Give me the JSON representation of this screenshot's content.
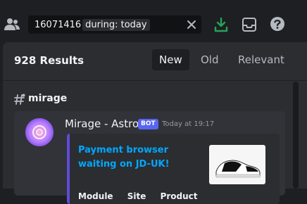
{
  "toolbar": {
    "search_query": "16071416",
    "search_filter": "during: today"
  },
  "results": {
    "count_label": "928 Results",
    "tabs": [
      "New",
      "Old",
      "Relevant"
    ],
    "active_tab": "New"
  },
  "channel": {
    "name": "mirage"
  },
  "message": {
    "author": "Mirage - Astro",
    "bot_tag": "BOT",
    "timestamp": "Today at 19:17",
    "embed": {
      "title": "Payment browser waiting on JD-UK!",
      "fields": [
        "Module",
        "Site",
        "Product"
      ]
    }
  },
  "colors": {
    "accent": "#5865f2",
    "link": "#00a8fc",
    "download_green": "#23a55a",
    "embed_bar": "#5f4bd8"
  }
}
